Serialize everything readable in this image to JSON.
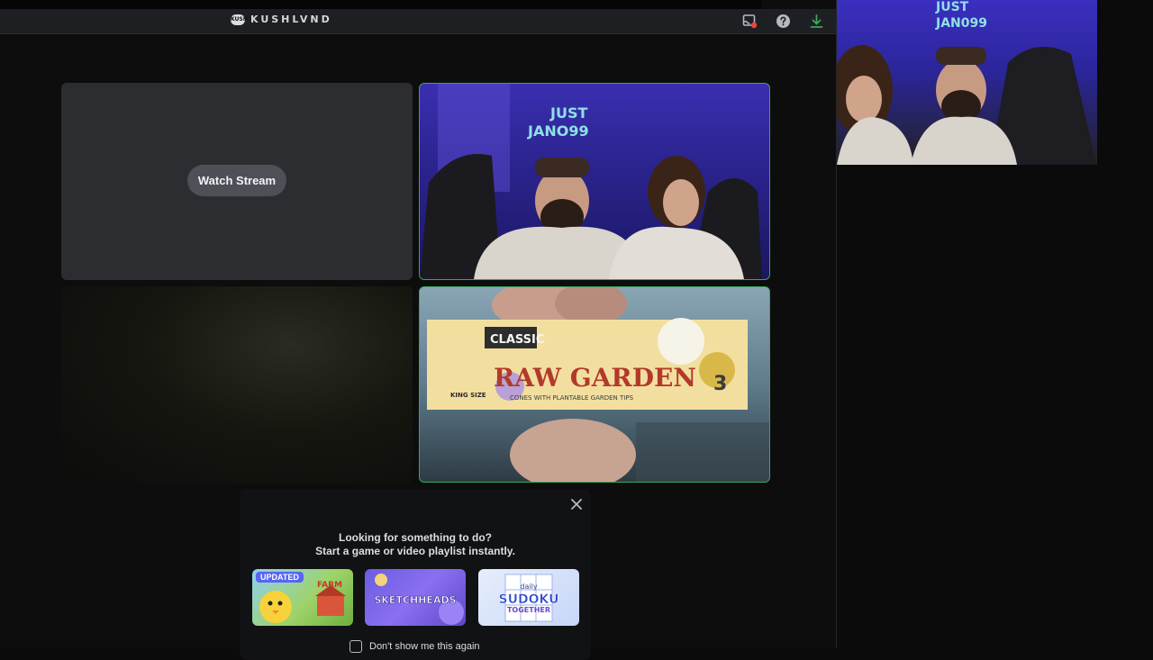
{
  "titlebar": {
    "logo_text": "KUSH",
    "brand": "KUSHLVND",
    "icons": [
      "inbox-icon",
      "help-icon",
      "download-icon"
    ],
    "download_color": "#3ba55c",
    "notification_color": "#ed4245"
  },
  "stage": {
    "empty_tile": {
      "button_label": "Watch Stream"
    },
    "speaking_color": "#3ba55c",
    "cam1": {
      "sign_text_1": "JUST",
      "sign_text_2": "JANO99"
    },
    "cam2": {
      "pack_label": "CLASSIC",
      "pack_brand": "RAW GARDEN",
      "pack_sub": "CONES WITH PLANTABLE GARDEN TIPS",
      "pack_size": "KING SIZE",
      "pack_number": "3"
    }
  },
  "popup": {
    "line1": "Looking for something to do?",
    "line2": "Start a game or video playlist instantly.",
    "activities": [
      {
        "badge": "UPDATED",
        "title": "FARM",
        "icon": "farm-game-thumbnail"
      },
      {
        "title": "SKETCHHEADS",
        "icon": "sketchheads-game-thumbnail"
      },
      {
        "title_top": "daily",
        "title": "SUDOKU",
        "title_bottom": "TOGETHER",
        "icon": "sudoku-game-thumbnail"
      }
    ],
    "checkbox_label": "Don't show me this again"
  },
  "pip": {
    "sign_text_1": "JUST",
    "sign_text_2": "JAN099"
  }
}
